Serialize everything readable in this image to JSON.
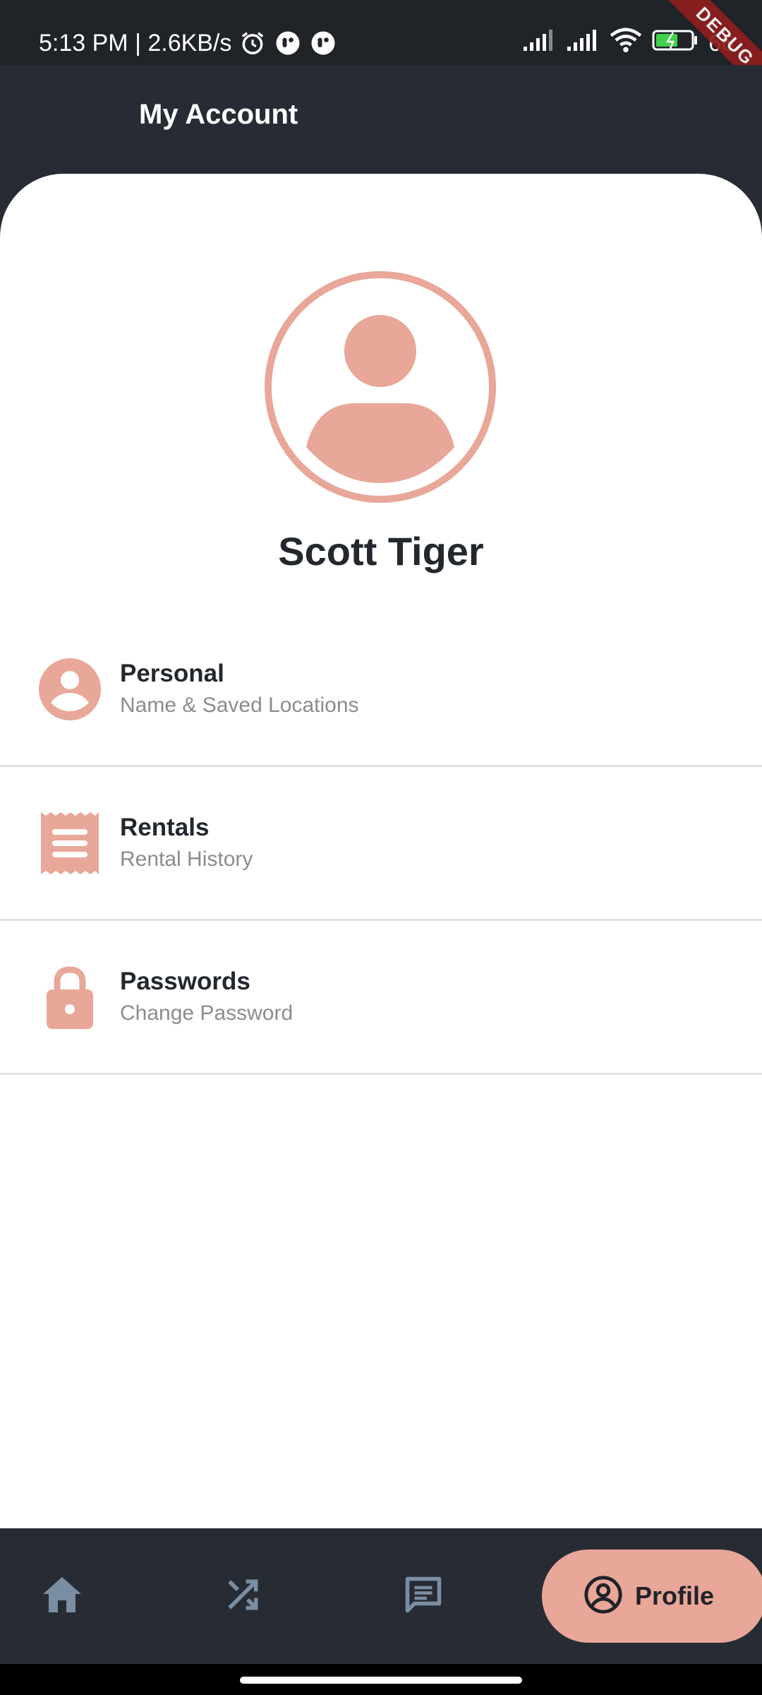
{
  "status_bar": {
    "time": "5:13 PM | 2.6KB/s",
    "battery": "66"
  },
  "debug_banner": "DEBUG",
  "app_bar": {
    "title": "My Account"
  },
  "profile": {
    "name": "Scott Tiger"
  },
  "menu": [
    {
      "icon": "person-icon",
      "title": "Personal",
      "subtitle": "Name & Saved Locations"
    },
    {
      "icon": "receipt-icon",
      "title": "Rentals",
      "subtitle": "Rental History"
    },
    {
      "icon": "lock-icon",
      "title": "Passwords",
      "subtitle": "Change Password"
    }
  ],
  "bottom_nav": {
    "items": [
      {
        "icon": "home-icon"
      },
      {
        "icon": "shuffle-icon"
      },
      {
        "icon": "messages-icon"
      },
      {
        "icon": "profile-icon",
        "label": "Profile",
        "selected": true
      }
    ]
  },
  "colors": {
    "accent": "#e8a798",
    "dark_background": "#272c34",
    "nav_icon": "#7a8ea3"
  }
}
